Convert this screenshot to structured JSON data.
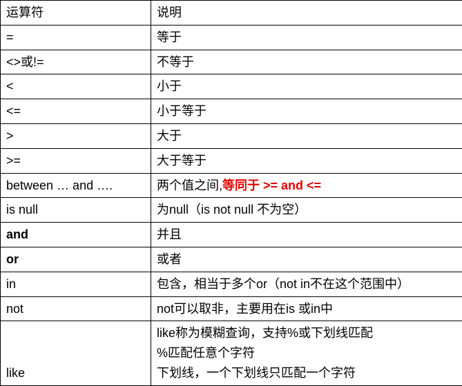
{
  "chart_data": {
    "type": "table",
    "title": "",
    "columns": [
      "运算符",
      "说明"
    ],
    "rows": [
      {
        "op": "=",
        "desc": "等于"
      },
      {
        "op": "<>或!=",
        "desc": "不等于"
      },
      {
        "op": "<",
        "desc": "小于"
      },
      {
        "op": "<=",
        "desc": "小于等于"
      },
      {
        "op": ">",
        "desc": "大于"
      },
      {
        "op": ">=",
        "desc": "大于等于"
      },
      {
        "op": "between … and ….",
        "desc_prefix": "两个值之间,",
        "desc_highlight": "等同于 >= and <="
      },
      {
        "op": "is null",
        "desc": "为null（is not null 不为空）"
      },
      {
        "op": "and",
        "op_bold": true,
        "desc": "并且"
      },
      {
        "op": "or",
        "op_bold": true,
        "desc": "或者"
      },
      {
        "op": "in",
        "desc": "包含，相当于多个or（not in不在这个范围中）"
      },
      {
        "op": "not",
        "desc": "not可以取非，主要用在is 或in中"
      },
      {
        "op": "like",
        "desc_lines": "like称为模糊查询，支持%或下划线匹配\n%匹配任意个字符\n下划线，一个下划线只匹配一个字符"
      }
    ]
  },
  "headers": {
    "op": "运算符",
    "desc": "说明"
  },
  "rows": {
    "eq": {
      "op": "=",
      "desc": "等于"
    },
    "neq": {
      "op": "<>或!=",
      "desc": "不等于"
    },
    "lt": {
      "op": "<",
      "desc": "小于"
    },
    "lte": {
      "op": "<=",
      "desc": "小于等于"
    },
    "gt": {
      "op": ">",
      "desc": "大于"
    },
    "gte": {
      "op": ">=",
      "desc": "大于等于"
    },
    "between": {
      "op": "between … and ….",
      "desc_prefix": "两个值之间,",
      "desc_highlight": "等同于 >= and <="
    },
    "isnull": {
      "op": "is null",
      "desc": "为null（is not null 不为空）"
    },
    "and": {
      "op": "and",
      "desc": "并且"
    },
    "or": {
      "op": "or",
      "desc": "或者"
    },
    "in": {
      "op": "in",
      "desc": "包含，相当于多个or（not in不在这个范围中）"
    },
    "not": {
      "op": "not",
      "desc": "not可以取非，主要用在is 或in中"
    },
    "like": {
      "op": "like",
      "desc_lines": "like称为模糊查询，支持%或下划线匹配\n%匹配任意个字符\n下划线，一个下划线只匹配一个字符"
    }
  }
}
